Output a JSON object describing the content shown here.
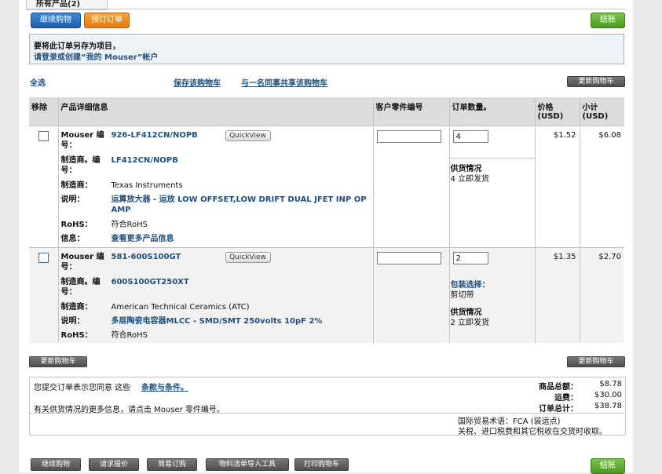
{
  "tab_label": "所有产品(2)",
  "top_buttons": {
    "continue": "继续购物",
    "preorder": "预订订单",
    "checkout": "结账"
  },
  "save_notice": {
    "line1": "要将此订单另存为项目，",
    "line2": "请登录或创建“我的 Mouser”帐户"
  },
  "toolbar": {
    "select_all": "全选",
    "save_cart": "保存该购物车",
    "share_cart": "与一名同事共享该购物车",
    "update_cart": "更新购物车"
  },
  "table_headers": {
    "remove": "移除",
    "details": "产品详细信息",
    "customer_part": "客户零件编号",
    "order_qty": "订单数量。",
    "price": "价格 (USD)",
    "subtotal": "小计 (USD)"
  },
  "items": [
    {
      "mouser_label": "Mouser 编号：",
      "mouser_no": "926-LF412CN/NOPB",
      "mfr_no_label": "制造商。编号：",
      "mfr_no": "LF412CN/NOPB",
      "mfr_label": "制造商：",
      "mfr": "Texas Instruments",
      "desc_label": "说明：",
      "desc": "运算放大器 - 运放 LOW OFFSET,LOW DRIFT DUAL JFET INP OP AMP",
      "rohs_label": "RoHS：",
      "rohs": "符合RoHS",
      "info_label": "信息：",
      "info": "查看更多产品信息",
      "quickview": "QuickView",
      "qty": "4",
      "avail_label": "供货情况",
      "avail": "4 立即发货",
      "price": "$1.52",
      "subtotal": "$6.08"
    },
    {
      "mouser_label": "Mouser 编号：",
      "mouser_no": "581-600S100GT",
      "mfr_no_label": "制造商。编号：",
      "mfr_no": "600S100GT250XT",
      "mfr_label": "制造商：",
      "mfr": "American Technical Ceramics (ATC)",
      "desc_label": "说明：",
      "desc": "多层陶瓷电容器MLCC - SMD/SMT 250volts 10pF 2%",
      "rohs_label": "RoHS：",
      "rohs": "符合RoHS",
      "quickview": "QuickView",
      "qty": "2",
      "pack_label": "包装选择：",
      "pack": "剪切带",
      "avail_label": "供货情况",
      "avail": "2 立即发货",
      "price": "$1.35",
      "subtotal": "$2.70"
    }
  ],
  "bottom_toolbar": {
    "update_cart": "更新购物车"
  },
  "summary": {
    "terms_prefix": "您提交订单表示您同意 这些",
    "terms_link": "条款与条件。",
    "supply_note": "有关供货情况的更多信息，请点击 Mouser 零件编号。",
    "goods_total_label": "商品总额：",
    "goods_total": "$8.78",
    "shipping_label": "运费：",
    "shipping": "$30.00",
    "order_total_label": "订单总计：",
    "order_total": "$38.78",
    "incoterm": "国际贸易术语：FCA (装运点)",
    "duties": "关税、进口税费和其它税收在交货时收取。"
  },
  "footer_buttons": {
    "continue": "继续购物",
    "quote": "请求报价",
    "reorder": "简易订购",
    "bom": "物料清单导入工具",
    "print": "打印购物车",
    "checkout": "结账"
  }
}
